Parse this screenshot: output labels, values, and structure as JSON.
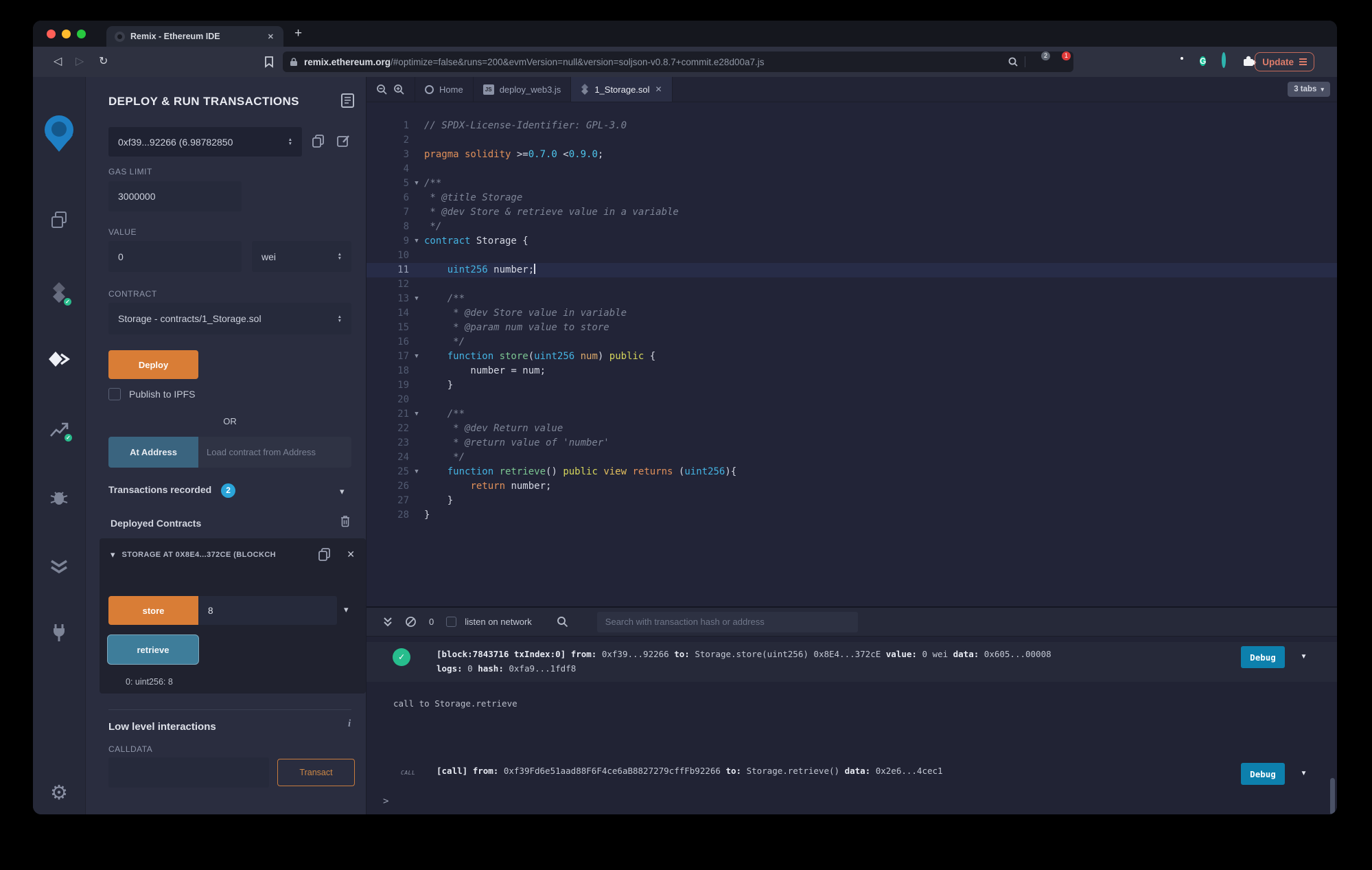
{
  "browser": {
    "tab_title": "Remix - Ethereum IDE",
    "new_tab": "+",
    "close_tab": "✕",
    "url_domain": "remix.ethereum.org",
    "url_rest": "/#optimize=false&runs=200&evmVersion=null&version=soljson-v0.8.7+commit.e28d00a7.js",
    "shield_badge": "2",
    "bat_badge": "1",
    "update_label": "Update",
    "icons": [
      "back-icon",
      "forward-icon",
      "reload-icon",
      "bookmark-icon",
      "lock-icon",
      "zoom-icon",
      "brave-shield-icon",
      "bat-icon",
      "metamask-icon",
      "tag-extension-icon",
      "grammarly-icon",
      "teal-extension-icon",
      "puzzle-extensions-icon"
    ]
  },
  "sidebar_icons": [
    "remix-logo",
    "file-explorer-icon",
    "solidity-compiler-icon",
    "deploy-run-icon",
    "solidity-analysis-icon",
    "debugger-icon",
    "unit-testing-icon",
    "plugin-manager-icon",
    "settings-gear-icon"
  ],
  "panel": {
    "title": "DEPLOY & RUN TRANSACTIONS",
    "account_value": "0xf39...92266 (6.98782850",
    "gas_label": "GAS LIMIT",
    "gas_value": "3000000",
    "value_label": "VALUE",
    "value_value": "0",
    "value_unit": "wei",
    "contract_label": "CONTRACT",
    "contract_value": "Storage - contracts/1_Storage.sol",
    "deploy_label": "Deploy",
    "publish_label": "Publish to IPFS",
    "or_label": "OR",
    "at_address_label": "At Address",
    "at_address_placeholder": "Load contract from Address",
    "tx_recorded_label": "Transactions recorded",
    "tx_recorded_count": "2",
    "deployed_label": "Deployed Contracts",
    "instance_title": "STORAGE AT 0X8E4...372CE (BLOCKCH",
    "store_label": "store",
    "store_value": "8",
    "retrieve_label": "retrieve",
    "retrieve_result": "0: uint256: 8",
    "low_level_label": "Low level interactions",
    "info_icon": "i",
    "calldata_label": "CALLDATA",
    "transact_label": "Transact"
  },
  "editor": {
    "tabs": [
      {
        "label": "Home"
      },
      {
        "label": "deploy_web3.js"
      },
      {
        "label": "1_Storage.sol",
        "active": true
      }
    ],
    "tabs_badge": "3 tabs",
    "lines": [
      {
        "n": 1,
        "tk": [
          [
            "comment",
            "// SPDX-License-Identifier: GPL-3.0"
          ]
        ]
      },
      {
        "n": 2,
        "tk": []
      },
      {
        "n": 3,
        "tk": [
          [
            "orange",
            "pragma solidity "
          ],
          [
            "plain",
            ">="
          ],
          [
            "cyan2",
            "0.7.0"
          ],
          [
            "plain",
            " <"
          ],
          [
            "cyan2",
            "0.9.0"
          ],
          [
            "plain",
            ";"
          ]
        ]
      },
      {
        "n": 4,
        "tk": []
      },
      {
        "n": 5,
        "fold": true,
        "tk": [
          [
            "comment",
            "/**"
          ]
        ]
      },
      {
        "n": 6,
        "tk": [
          [
            "comment",
            " * @title Storage"
          ]
        ]
      },
      {
        "n": 7,
        "tk": [
          [
            "comment",
            " * @dev Store & retrieve value in a variable"
          ]
        ]
      },
      {
        "n": 8,
        "tk": [
          [
            "comment",
            " */"
          ]
        ]
      },
      {
        "n": 9,
        "fold": true,
        "tk": [
          [
            "cyan",
            "contract "
          ],
          [
            "plain",
            "Storage {"
          ]
        ]
      },
      {
        "n": 10,
        "tk": []
      },
      {
        "n": 11,
        "active": true,
        "cursor": true,
        "tk": [
          [
            "plain",
            "    "
          ],
          [
            "cyan",
            "uint256"
          ],
          [
            "plain",
            " number;"
          ]
        ]
      },
      {
        "n": 12,
        "tk": []
      },
      {
        "n": 13,
        "fold": true,
        "tk": [
          [
            "comment",
            "    /**"
          ]
        ]
      },
      {
        "n": 14,
        "tk": [
          [
            "comment",
            "     * @dev Store value in variable"
          ]
        ]
      },
      {
        "n": 15,
        "tk": [
          [
            "comment",
            "     * @param num value to store"
          ]
        ]
      },
      {
        "n": 16,
        "tk": [
          [
            "comment",
            "     */"
          ]
        ]
      },
      {
        "n": 17,
        "fold": true,
        "tk": [
          [
            "plain",
            "    "
          ],
          [
            "cyan",
            "function "
          ],
          [
            "green",
            "store"
          ],
          [
            "plain",
            "("
          ],
          [
            "cyan",
            "uint256"
          ],
          [
            "plain",
            " "
          ],
          [
            "tan",
            "num"
          ],
          [
            "plain",
            ") "
          ],
          [
            "yellow",
            "public"
          ],
          [
            "plain",
            " {"
          ]
        ]
      },
      {
        "n": 18,
        "tk": [
          [
            "plain",
            "        number = num;"
          ]
        ]
      },
      {
        "n": 19,
        "tk": [
          [
            "plain",
            "    }"
          ]
        ]
      },
      {
        "n": 20,
        "tk": []
      },
      {
        "n": 21,
        "fold": true,
        "tk": [
          [
            "comment",
            "    /**"
          ]
        ]
      },
      {
        "n": 22,
        "tk": [
          [
            "comment",
            "     * @dev Return value"
          ]
        ]
      },
      {
        "n": 23,
        "tk": [
          [
            "comment",
            "     * @return value of 'number'"
          ]
        ]
      },
      {
        "n": 24,
        "tk": [
          [
            "comment",
            "     */"
          ]
        ]
      },
      {
        "n": 25,
        "fold": true,
        "tk": [
          [
            "plain",
            "    "
          ],
          [
            "cyan",
            "function "
          ],
          [
            "green",
            "retrieve"
          ],
          [
            "plain",
            "() "
          ],
          [
            "yellow",
            "public"
          ],
          [
            "plain",
            " "
          ],
          [
            "yellow2",
            "view"
          ],
          [
            "plain",
            " "
          ],
          [
            "orange",
            "returns"
          ],
          [
            "plain",
            " ("
          ],
          [
            "cyan",
            "uint256"
          ],
          [
            "plain",
            "){"
          ]
        ]
      },
      {
        "n": 26,
        "tk": [
          [
            "plain",
            "        "
          ],
          [
            "orange",
            "return"
          ],
          [
            "plain",
            " number;"
          ]
        ]
      },
      {
        "n": 27,
        "tk": [
          [
            "plain",
            "    }"
          ]
        ]
      },
      {
        "n": 28,
        "tk": [
          [
            "plain",
            "}"
          ]
        ]
      }
    ]
  },
  "terminal": {
    "count": "0",
    "listen_label": "listen on network",
    "search_placeholder": "Search with transaction hash or address",
    "debug_label": "Debug",
    "prompt": ">",
    "entries": [
      {
        "kind": "tx",
        "rows": [
          [
            [
              "b",
              "[block:7843716 txIndex:0]"
            ],
            [
              "n",
              " "
            ],
            [
              "b",
              "from:"
            ],
            [
              "n",
              " 0xf39...92266 "
            ],
            [
              "b",
              "to:"
            ],
            [
              "n",
              " Storage.store(uint256) 0x8E4...372cE "
            ],
            [
              "b",
              "value:"
            ],
            [
              "n",
              " 0 wei "
            ],
            [
              "b",
              "data:"
            ],
            [
              "n",
              " 0x605...00008 "
            ]
          ],
          [
            [
              "b",
              "logs:"
            ],
            [
              "n",
              " 0 "
            ],
            [
              "b",
              "hash:"
            ],
            [
              "n",
              " 0xfa9...1fdf8"
            ]
          ]
        ],
        "debug": true
      },
      {
        "kind": "plain",
        "text": "call to Storage.retrieve"
      },
      {
        "kind": "call",
        "tag": "CALL",
        "rows": [
          [
            [
              "b",
              "[call]"
            ],
            [
              "n",
              " "
            ],
            [
              "b",
              "from:"
            ],
            [
              "n",
              " 0xf39Fd6e51aad88F6F4ce6aB8827279cffFb92266 "
            ],
            [
              "b",
              "to:"
            ],
            [
              "n",
              " Storage.retrieve() "
            ],
            [
              "b",
              "data:"
            ],
            [
              "n",
              " 0x2e6...4cec1"
            ]
          ]
        ],
        "debug": true
      }
    ]
  },
  "colors": {
    "accent_orange": "#d97d36",
    "accent_blue_button": "#0d80ad",
    "success_green": "#27bd8d",
    "badge_blue": "#2aa4d8",
    "brave_orange": "#fb542b",
    "update_red": "#dd7d6b",
    "remix_blue": "#1e7fc4"
  }
}
